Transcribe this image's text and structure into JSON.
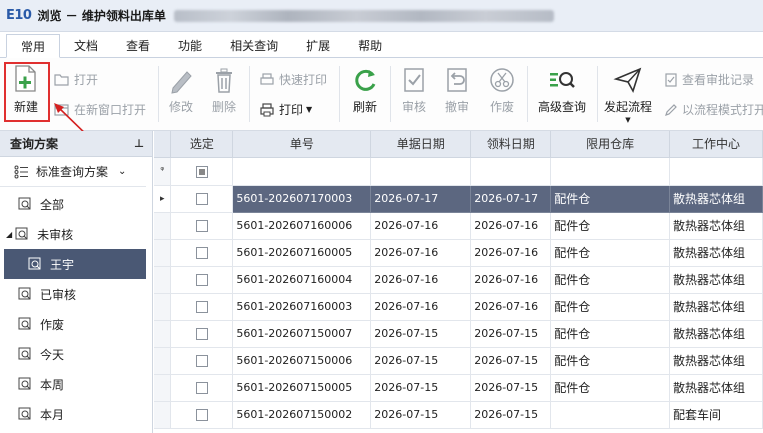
{
  "window": {
    "logo": "E10",
    "title": "浏览 － 维护领料出库单"
  },
  "menu": {
    "tabs": [
      "常用",
      "文档",
      "查看",
      "功能",
      "相关查询",
      "扩展",
      "帮助"
    ]
  },
  "toolbar": {
    "new": "新建",
    "open": "打开",
    "open_new_window": "在新窗口打开",
    "edit": "修改",
    "delete": "删除",
    "quick_print": "快速打印",
    "print": "打印",
    "refresh": "刷新",
    "review": "审核",
    "unreview": "撤审",
    "void": "作废",
    "advanced_query": "高级查询",
    "start_flow": "发起流程",
    "view_review_record": "查看审批记录",
    "flow_open": "以流程模式打开"
  },
  "left_panel": {
    "header": "查询方案",
    "pin": "ᵖ",
    "scheme": "标准查询方案",
    "items": [
      {
        "label": "全部"
      },
      {
        "label": "未审核"
      },
      {
        "label": "王宇"
      },
      {
        "label": "已审核"
      },
      {
        "label": "作废"
      },
      {
        "label": "今天"
      },
      {
        "label": "本周"
      },
      {
        "label": "本月"
      }
    ]
  },
  "grid": {
    "columns": [
      "选定",
      "单号",
      "单据日期",
      "领料日期",
      "限用仓库",
      "工作中心"
    ],
    "rows": [
      {
        "no": "5601-202607170003",
        "doc_date": "2026-07-17",
        "pick_date": "2026-07-17",
        "warehouse": "配件仓",
        "center": "散热器芯体组"
      },
      {
        "no": "5601-202607160006",
        "doc_date": "2026-07-16",
        "pick_date": "2026-07-16",
        "warehouse": "配件仓",
        "center": "散热器芯体组"
      },
      {
        "no": "5601-202607160005",
        "doc_date": "2026-07-16",
        "pick_date": "2026-07-16",
        "warehouse": "配件仓",
        "center": "散热器芯体组"
      },
      {
        "no": "5601-202607160004",
        "doc_date": "2026-07-16",
        "pick_date": "2026-07-16",
        "warehouse": "配件仓",
        "center": "散热器芯体组"
      },
      {
        "no": "5601-202607160003",
        "doc_date": "2026-07-16",
        "pick_date": "2026-07-16",
        "warehouse": "配件仓",
        "center": "散热器芯体组"
      },
      {
        "no": "5601-202607150007",
        "doc_date": "2026-07-15",
        "pick_date": "2026-07-15",
        "warehouse": "配件仓",
        "center": "散热器芯体组"
      },
      {
        "no": "5601-202607150006",
        "doc_date": "2026-07-15",
        "pick_date": "2026-07-15",
        "warehouse": "配件仓",
        "center": "散热器芯体组"
      },
      {
        "no": "5601-202607150005",
        "doc_date": "2026-07-15",
        "pick_date": "2026-07-15",
        "warehouse": "配件仓",
        "center": "散热器芯体组"
      },
      {
        "no": "5601-202607150002",
        "doc_date": "2026-07-15",
        "pick_date": "2026-07-15",
        "warehouse": "",
        "center": "配套车间"
      }
    ]
  },
  "colors": {
    "accent_green": "#3aa14a",
    "selection": "#5c6780",
    "highlight_red": "#e03030"
  }
}
